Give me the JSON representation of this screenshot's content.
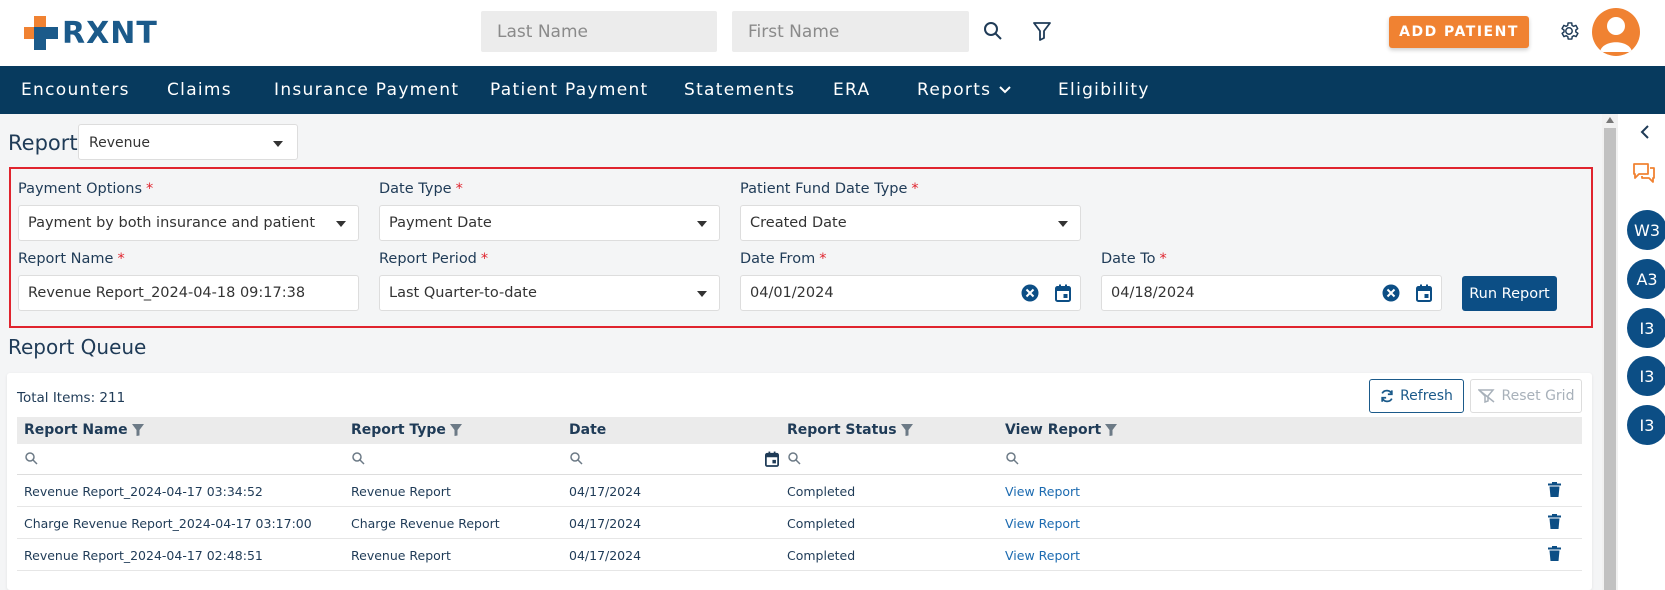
{
  "header": {
    "logo_text": "RXNT",
    "last_name_placeholder": "Last Name",
    "first_name_placeholder": "First Name",
    "add_patient_label": "ADD PATIENT"
  },
  "nav": {
    "items": [
      "Encounters",
      "Claims",
      "Insurance Payment",
      "Patient Payment",
      "Statements",
      "ERA",
      "Reports",
      "Eligibility"
    ]
  },
  "report": {
    "label": "Report",
    "selected": "Revenue"
  },
  "form": {
    "payment_options_label": "Payment Options",
    "payment_options_value": "Payment by both insurance and patient",
    "date_type_label": "Date Type",
    "date_type_value": "Payment Date",
    "patient_fund_label": "Patient Fund Date Type",
    "patient_fund_value": "Created Date",
    "report_name_label": "Report Name",
    "report_name_value": "Revenue Report_2024-04-18 09:17:38",
    "report_period_label": "Report Period",
    "report_period_value": "Last Quarter-to-date",
    "date_from_label": "Date From",
    "date_from_value": "04/01/2024",
    "date_to_label": "Date To",
    "date_to_value": "04/18/2024",
    "required_mark": "*",
    "run_report_label": "Run Report"
  },
  "queue": {
    "title": "Report Queue",
    "total_items": "Total Items: 211",
    "refresh_label": "Refresh",
    "reset_grid_label": "Reset Grid",
    "columns": [
      "Report Name",
      "Report Type",
      "Date",
      "Report Status",
      "View Report"
    ],
    "rows": [
      {
        "name": "Revenue Report_2024-04-17 03:34:52",
        "type": "Revenue Report",
        "date": "04/17/2024",
        "status": "Completed",
        "view": "View Report"
      },
      {
        "name": "Charge Revenue Report_2024-04-17 03:17:00",
        "type": "Charge Revenue Report",
        "date": "04/17/2024",
        "status": "Completed",
        "view": "View Report"
      },
      {
        "name": "Revenue Report_2024-04-17 02:48:51",
        "type": "Revenue Report",
        "date": "04/17/2024",
        "status": "Completed",
        "view": "View Report"
      }
    ]
  },
  "side_panel": {
    "chips": [
      "W3",
      "A3",
      "I3",
      "I3",
      "I3"
    ]
  },
  "colors": {
    "nav_bg": "#073a5e",
    "accent_orange": "#f08232",
    "primary_blue": "#0c4e85",
    "required_red": "#e0242e",
    "link_blue": "#1b6ab0"
  },
  "icons": [
    "search-icon",
    "filter-icon",
    "gear-icon",
    "user-avatar-icon",
    "chevron-down-icon",
    "clear-circle-icon",
    "calendar-icon",
    "refresh-icon",
    "reset-filter-icon",
    "trash-icon",
    "chevron-left-icon",
    "chat-icon"
  ]
}
